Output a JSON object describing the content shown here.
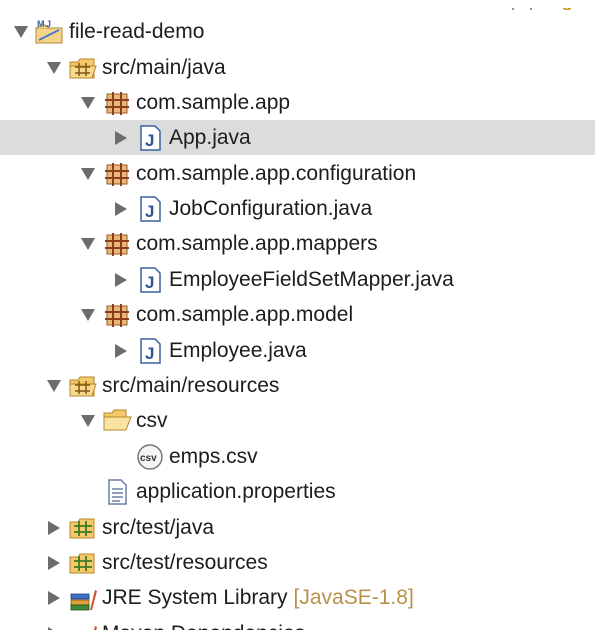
{
  "tree": {
    "project": {
      "label": "file-read-demo",
      "icon": "maven-java-project-icon"
    },
    "src_main_java": {
      "label": "src/main/java",
      "icon": "source-folder-icon"
    },
    "pkg_app": {
      "label": "com.sample.app",
      "icon": "package-icon"
    },
    "file_app": {
      "label": "App.java",
      "icon": "java-file-icon"
    },
    "pkg_config": {
      "label": "com.sample.app.configuration",
      "icon": "package-icon"
    },
    "file_job": {
      "label": "JobConfiguration.java",
      "icon": "java-file-icon"
    },
    "pkg_mappers": {
      "label": "com.sample.app.mappers",
      "icon": "package-icon"
    },
    "file_mapper": {
      "label": "EmployeeFieldSetMapper.java",
      "icon": "java-file-icon"
    },
    "pkg_model": {
      "label": "com.sample.app.model",
      "icon": "package-icon"
    },
    "file_employee": {
      "label": "Employee.java",
      "icon": "java-file-icon"
    },
    "src_main_resources": {
      "label": "src/main/resources",
      "icon": "source-folder-icon"
    },
    "folder_csv": {
      "label": "csv",
      "icon": "folder-open-icon"
    },
    "file_emps": {
      "label": "emps.csv",
      "icon": "csv-file-icon"
    },
    "file_props": {
      "label": "application.properties",
      "icon": "properties-file-icon"
    },
    "src_test_java": {
      "label": "src/test/java",
      "icon": "source-folder-icon"
    },
    "src_test_resources": {
      "label": "src/test/resources",
      "icon": "source-folder-icon"
    },
    "jre": {
      "label": "JRE System Library",
      "decoration": "[JavaSE-1.8]",
      "icon": "library-icon"
    },
    "maven": {
      "label": "Maven Dependencies",
      "icon": "library-icon"
    }
  },
  "selected": "App.java",
  "colors": {
    "selection": "#dcdcdc",
    "decoration": "#b8914a",
    "text": "#1d1d1d"
  }
}
